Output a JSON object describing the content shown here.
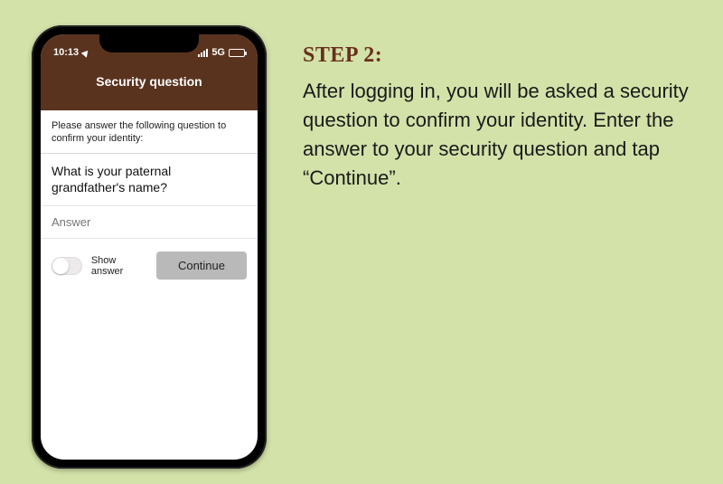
{
  "phone": {
    "status": {
      "time": "10:13",
      "network": "5G"
    },
    "header_title": "Security question",
    "prompt": "Please answer the following question to confirm your identity:",
    "question": "What is your paternal grandfather's name?",
    "answer_placeholder": "Answer",
    "show_answer_label": "Show answer",
    "continue_label": "Continue"
  },
  "instructions": {
    "step_title": "STEP 2:",
    "body": "After logging in, you will be asked a security question to confirm your identity.  Enter the answer to your security question and tap “Continue”."
  },
  "colors": {
    "page_bg": "#d3e2a9",
    "brand_brown": "#5a331e",
    "step_title": "#69301b",
    "button_gray": "#b9b9b9"
  }
}
